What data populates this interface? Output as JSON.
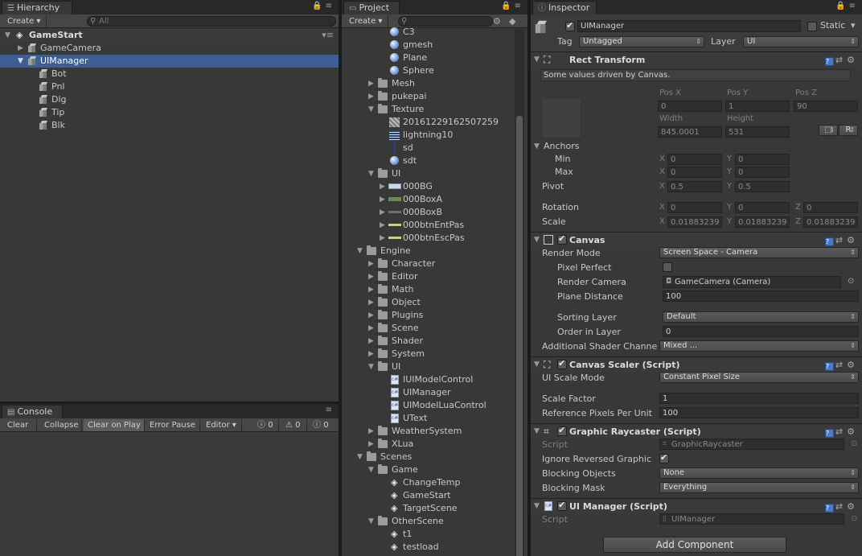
{
  "hierarchy": {
    "tab": "Hierarchy",
    "create": "Create",
    "search_placeholder": "All",
    "scene": "GameStart",
    "items": [
      "GameCamera",
      "UIManager",
      "Bot",
      "Pnl",
      "Dlg",
      "Tip",
      "Blk"
    ]
  },
  "console": {
    "tab": "Console",
    "buttons": [
      "Clear",
      "Collapse",
      "Clear on Play",
      "Error Pause",
      "Editor"
    ],
    "counts": [
      "0",
      "0",
      "0"
    ]
  },
  "project": {
    "tab": "Project",
    "create": "Create",
    "items": [
      "C3",
      "gmesh",
      "Plane",
      "Sphere",
      "Mesh",
      "pukepai",
      "Texture",
      "20161229162507259",
      "lightning10",
      "sd",
      "sdt",
      "UI",
      "000BG",
      "000BoxA",
      "000BoxB",
      "000btnEntPas",
      "000btnEscPas",
      "Engine",
      "Character",
      "Editor",
      "Math",
      "Object",
      "Plugins",
      "Scene",
      "Shader",
      "System",
      "UI",
      "IUIModelControl",
      "UIManager",
      "UIModelLuaControl",
      "UText",
      "WeatherSystem",
      "XLua",
      "Scenes",
      "Game",
      "ChangeTemp",
      "GameStart",
      "TargetScene",
      "OtherScene",
      "t1",
      "testload"
    ]
  },
  "inspector": {
    "tab": "Inspector",
    "object_name": "UIManager",
    "static_label": "Static",
    "tag_label": "Tag",
    "tag_value": "Untagged",
    "layer_label": "Layer",
    "layer_value": "UI",
    "rect": {
      "title": "Rect Transform",
      "note": "Some values driven by Canvas.",
      "pos_x_label": "Pos X",
      "pos_y_label": "Pos Y",
      "pos_z_label": "Pos Z",
      "pos_x": "0",
      "pos_y": "1",
      "pos_z": "90",
      "width_label": "Width",
      "height_label": "Height",
      "width": "845.0001",
      "height": "531",
      "r_button": "R",
      "anchors": "Anchors",
      "min": "Min",
      "max": "Max",
      "min_x": "0",
      "min_y": "0",
      "max_x": "0",
      "max_y": "0",
      "pivot": "Pivot",
      "pivot_x": "0.5",
      "pivot_y": "0.5",
      "rotation": "Rotation",
      "rot_x": "0",
      "rot_y": "0",
      "rot_z": "0",
      "scale": "Scale",
      "scale_x": "0.01883239",
      "scale_y": "0.01883239",
      "scale_z": "0.01883239",
      "x": "X",
      "y": "Y",
      "z": "Z"
    },
    "canvas": {
      "title": "Canvas",
      "render_mode_label": "Render Mode",
      "render_mode": "Screen Space - Camera",
      "pixel_perfect_label": "Pixel Perfect",
      "render_camera_label": "Render Camera",
      "render_camera": "GameCamera (Camera)",
      "plane_distance_label": "Plane Distance",
      "plane_distance": "100",
      "sorting_layer_label": "Sorting Layer",
      "sorting_layer": "Default",
      "order_label": "Order in Layer",
      "order": "0",
      "shader_channels_label": "Additional Shader Channe",
      "shader_channels": "Mixed ..."
    },
    "scaler": {
      "title": "Canvas Scaler (Script)",
      "mode_label": "UI Scale Mode",
      "mode": "Constant Pixel Size",
      "factor_label": "Scale Factor",
      "factor": "1",
      "ppu_label": "Reference Pixels Per Unit",
      "ppu": "100"
    },
    "raycaster": {
      "title": "Graphic Raycaster (Script)",
      "script_label": "Script",
      "script": "GraphicRaycaster",
      "ignore_label": "Ignore Reversed Graphic",
      "blocking_label": "Blocking Objects",
      "blocking": "None",
      "mask_label": "Blocking Mask",
      "mask": "Everything"
    },
    "uimanager": {
      "title": "UI Manager (Script)",
      "script_label": "Script",
      "script": "UIManager"
    },
    "add_component": "Add Component"
  },
  "icons": {
    "menu": "menu-lines-icon",
    "lock": "lock-icon",
    "help": "help-book-icon",
    "settings": "gear-icon"
  },
  "colors": {
    "selection": "#3e5f96",
    "panel": "#383838",
    "accent_blue": "#4b79c4"
  }
}
